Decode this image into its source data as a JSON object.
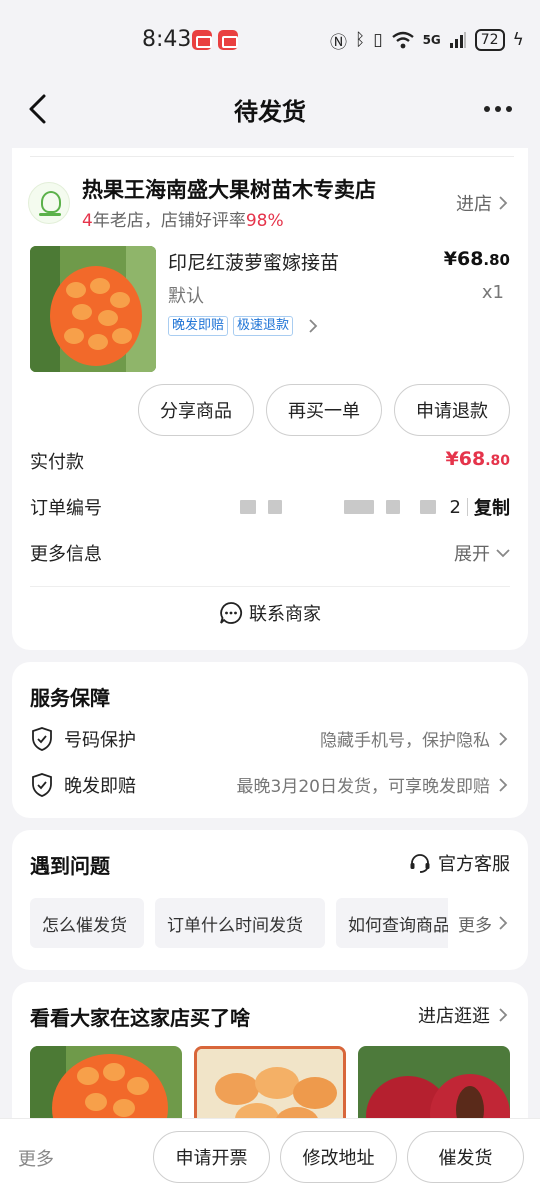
{
  "status_bar": {
    "time": "8:43",
    "network": "5G",
    "battery": "72"
  },
  "header": {
    "title": "待发货"
  },
  "shop": {
    "name": "热果王海南盛大果树苗木专卖店",
    "years": "4",
    "years_suffix": "年老店，店铺好评率",
    "rating": "98%",
    "enter_label": "进店"
  },
  "product": {
    "name": "印尼红菠萝蜜嫁接苗",
    "price_main": "¥68",
    "price_decimal": ".80",
    "spec": "默认",
    "quantity": "x1",
    "tags": [
      "晚发即赔",
      "极速退款"
    ]
  },
  "order_actions": {
    "share": "分享商品",
    "rebuy": "再买一单",
    "refund": "申请退款"
  },
  "order_info": {
    "paid_label": "实付款",
    "paid_main": "¥68",
    "paid_decimal": ".80",
    "order_no_label": "订单编号",
    "order_no_tail": "2",
    "copy_label": "复制",
    "more_info_label": "更多信息",
    "expand_label": "展开",
    "contact_label": "联系商家"
  },
  "service": {
    "title": "服务保障",
    "items": [
      {
        "label": "号码保护",
        "desc": "隐藏手机号，保护隐私"
      },
      {
        "label": "晚发即赔",
        "desc": "最晚3月20日发货，可享晚发即赔"
      }
    ]
  },
  "problems": {
    "title": "遇到问题",
    "service_label": "官方客服",
    "questions": [
      "怎么催发货",
      "订单什么时间发货",
      "如何查询商品"
    ],
    "more_label": "更多"
  },
  "recommend": {
    "title": "看看大家在这家店买了啥",
    "link_label": "进店逛逛"
  },
  "bottom_bar": {
    "more": "更多",
    "invoice": "申请开票",
    "modify_address": "修改地址",
    "urge": "催发货"
  },
  "colors": {
    "accent_red": "#e5344b",
    "tag_blue": "#1f74d6",
    "background": "#f3f3f6"
  }
}
